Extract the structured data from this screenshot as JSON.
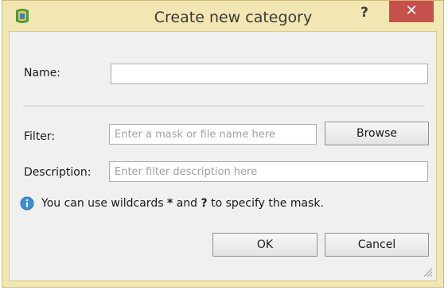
{
  "window": {
    "title": "Create new category",
    "help_label": "?",
    "close_label": "✕"
  },
  "form": {
    "name_label": "Name:",
    "name_value": "",
    "filter_label": "Filter:",
    "filter_placeholder": "Enter a mask or file name here",
    "browse_label": "Browse",
    "description_label": "Description:",
    "description_placeholder": "Enter filter description here"
  },
  "info": {
    "icon": "info-icon",
    "text_before": "You can use wildcards ",
    "wildcard_star": "*",
    "text_and": " and ",
    "wildcard_q": "?",
    "text_after": " to specify the mask."
  },
  "buttons": {
    "ok_label": "OK",
    "cancel_label": "Cancel"
  },
  "colors": {
    "frame": "#f2e6b2",
    "close": "#c8504b",
    "info": "#3b8fd6"
  }
}
